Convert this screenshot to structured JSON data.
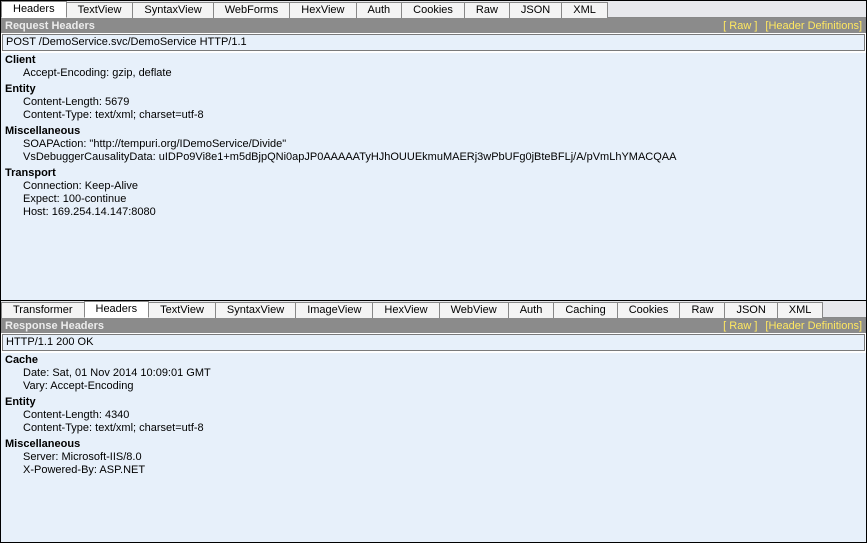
{
  "request": {
    "tabs": [
      "Headers",
      "TextView",
      "SyntaxView",
      "WebForms",
      "HexView",
      "Auth",
      "Cookies",
      "Raw",
      "JSON",
      "XML"
    ],
    "activeTab": "Headers",
    "sectionTitle": "Request Headers",
    "links": {
      "raw": "[ Raw ]",
      "defs": "[Header Definitions]"
    },
    "firstLine": "POST /DemoService.svc/DemoService HTTP/1.1",
    "groups": [
      {
        "title": "Client",
        "lines": [
          "Accept-Encoding: gzip, deflate"
        ]
      },
      {
        "title": "Entity",
        "lines": [
          "Content-Length: 5679",
          "Content-Type: text/xml; charset=utf-8"
        ]
      },
      {
        "title": "Miscellaneous",
        "lines": [
          "SOAPAction: \"http://tempuri.org/IDemoService/Divide\"",
          "VsDebuggerCausalityData: uIDPo9Vi8e1+m5dBjpQNi0apJP0AAAAATyHJhOUUEkmuMAERj3wPbUFg0jBteBFLj/A/pVmLhYMACQAA"
        ]
      },
      {
        "title": "Transport",
        "lines": [
          "Connection: Keep-Alive",
          "Expect: 100-continue",
          "Host: 169.254.14.147:8080"
        ]
      }
    ]
  },
  "response": {
    "tabs": [
      "Transformer",
      "Headers",
      "TextView",
      "SyntaxView",
      "ImageView",
      "HexView",
      "WebView",
      "Auth",
      "Caching",
      "Cookies",
      "Raw",
      "JSON",
      "XML"
    ],
    "activeTab": "Headers",
    "sectionTitle": "Response Headers",
    "links": {
      "raw": "[ Raw ]",
      "defs": "[Header Definitions]"
    },
    "firstLine": "HTTP/1.1 200 OK",
    "groups": [
      {
        "title": "Cache",
        "lines": [
          "Date: Sat, 01 Nov 2014 10:09:01 GMT",
          "Vary: Accept-Encoding"
        ]
      },
      {
        "title": "Entity",
        "lines": [
          "Content-Length: 4340",
          "Content-Type: text/xml; charset=utf-8"
        ]
      },
      {
        "title": "Miscellaneous",
        "lines": [
          "Server: Microsoft-IIS/8.0",
          "X-Powered-By: ASP.NET"
        ]
      }
    ]
  }
}
